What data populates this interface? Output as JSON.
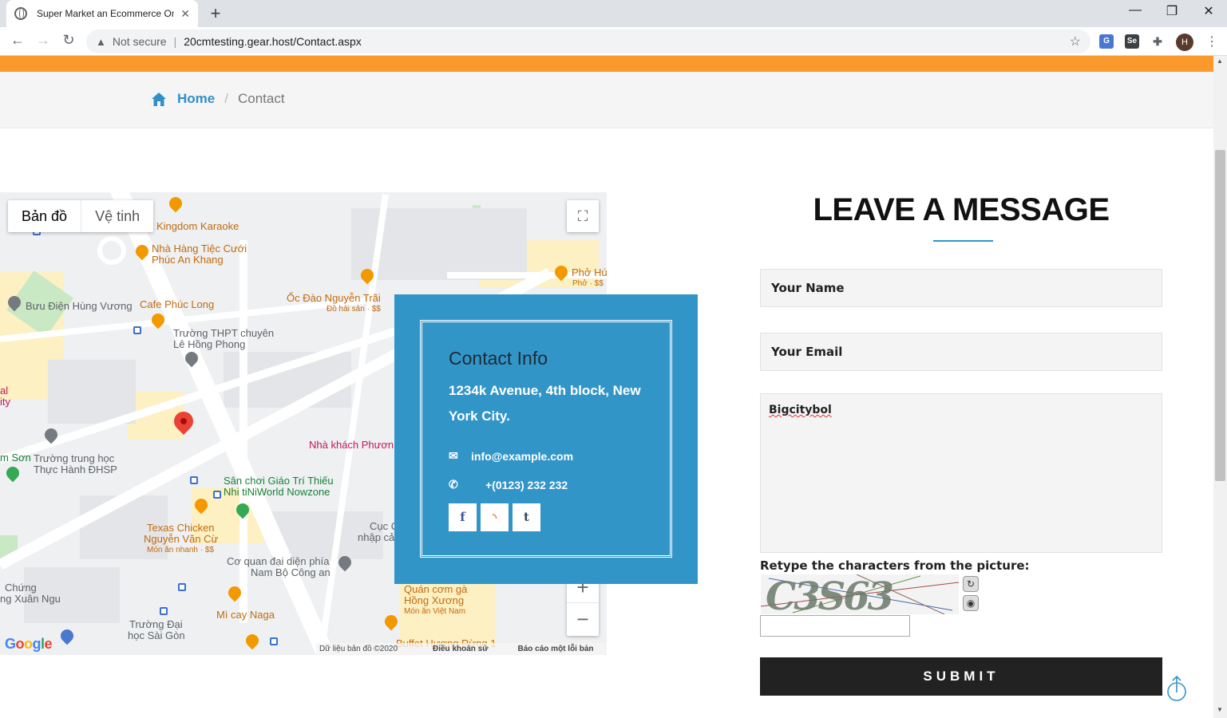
{
  "browser": {
    "tab_title": "Super Market an Ecommerce Onl",
    "new_tab": "+",
    "minimize": "—",
    "maximize": "❐",
    "close": "✕",
    "security_label": "Not secure",
    "url": "20cmtesting.gear.host/Contact.aspx",
    "avatar_initial": "H"
  },
  "breadcrumb": {
    "home": "Home",
    "separator": "/",
    "current": "Contact"
  },
  "map": {
    "type_map": "Bản đồ",
    "type_satellite": "Vệ tinh",
    "labels": {
      "kingdom": "Kingdom Karaoke",
      "nha_hang_1": "Nhà Hàng Tiệc Cưới",
      "nha_hang_2": "Phúc An Khang",
      "pho_hu": "Phở Hú",
      "pho_sub": "Phở · $$",
      "buu_dien": "Bưu Điện Hùng Vương",
      "cafe": "Cafe Phúc Long",
      "oc_dao": "Ốc Đào Nguyễn Trãi",
      "oc_sub": "Đồ hải sản · $$",
      "thpt_1": "Trường THPT chuyên",
      "thpt_2": "Lê Hồng Phong",
      "al": "al",
      "ity": "ity",
      "nha_khach": "Nhà khách Phươn",
      "m_son": "m Sơn",
      "truong_th_1": "Trường trung học",
      "truong_th_2": "Thực Hành ĐHSP",
      "san_choi_1": "Sân chơi Giáo Trí Thiếu",
      "san_choi_2": "Nhi tiNiWorld Nowzone",
      "texas_1": "Texas Chicken",
      "texas_2": "Nguyễn Văn Cừ",
      "texas_sub": "Món ăn nhanh · $$",
      "cuc_1": "Cục C",
      "cuc_2": "nhập cả",
      "co_quan_1": "Cơ quan đại diện phía",
      "co_quan_2": "Nam Bộ Công an",
      "chung_1": "Chứng",
      "chung_2": "ng Xuân Ngu",
      "mi_cay": "Mì cay Naga",
      "quan_com_1": "Quán cơm gà",
      "quan_com_2": "Hồng Xương",
      "quan_com_sub": "Món ăn Việt Nam",
      "dai_hoc_1": "Trường Đại",
      "dai_hoc_2": "học Sài Gòn",
      "buffet": "Buffet Hương Rừng 1"
    },
    "zoom_in": "+",
    "zoom_out": "−",
    "google": "Google",
    "attribution": "Dữ liệu bản đồ ©2020 Google",
    "terms": "Điều khoản sử dụng",
    "report": "Báo cáo một lỗi bản đồ"
  },
  "contact": {
    "title": "Contact Info",
    "address": "1234k Avenue, 4th block, New York City.",
    "email": "info@example.com",
    "phone": "+(0123) 232 232",
    "social": [
      "f",
      "rss",
      "t"
    ]
  },
  "form": {
    "title": "LEAVE A MESSAGE",
    "name_placeholder": "Your Name",
    "email_placeholder": "Your Email",
    "message_value": "Bigcitybol",
    "captcha_label": "Retype the characters from the picture:",
    "captcha_text": "C3S63",
    "submit": "SUBMIT"
  },
  "colors": {
    "accent_orange": "#fa9a2c",
    "accent_blue": "#3295c8",
    "submit_bg": "#222222"
  }
}
